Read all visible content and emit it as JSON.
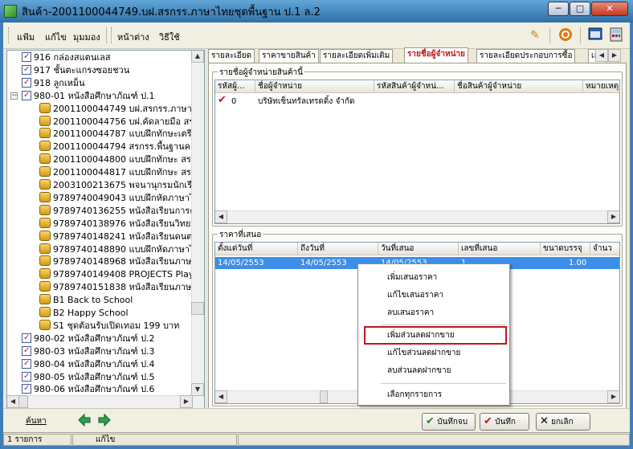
{
  "window": {
    "title": "สินค้า-2001100044749.บฝ.สรกรร.ภาษาไทยชุดพื้นฐาน ป.1 ล.2",
    "minimize": "─",
    "maximize": "□",
    "close": "✕"
  },
  "menu": {
    "items": [
      "แฟ้ม",
      "แก้ไข",
      "มุมมอง",
      "หน้าต่าง",
      "วิธีใช้"
    ]
  },
  "tree": {
    "rows": [
      {
        "kind": "cat",
        "text": "916 กล่องสแตนเลส"
      },
      {
        "kind": "cat",
        "text": "917 ชั้นตะแกรงซอยชวน"
      },
      {
        "kind": "cat",
        "text": "918 ลูกเหม็น"
      },
      {
        "kind": "cat",
        "text": "980-01 หนังสือศึกษาภัณฑ์ ป.1"
      },
      {
        "kind": "item",
        "text": "2001100044749 บฝ.สรกรร.ภาษาไท"
      },
      {
        "kind": "item",
        "text": "2001100044756 บฝ.คัดลายมือ สรกร"
      },
      {
        "kind": "item",
        "text": "2001100044787 แบบฝึกทักษะเตรีย"
      },
      {
        "kind": "item",
        "text": "2001100044794 สรกรร.พื้นฐานคณิต"
      },
      {
        "kind": "item",
        "text": "2001100044800 แบบฝึกทักษะ สรกร"
      },
      {
        "kind": "item",
        "text": "2001100044817 แบบฝึกทักษะ สรกร"
      },
      {
        "kind": "item",
        "text": "2003100213675 พจนานุกรมนักเรีย"
      },
      {
        "kind": "item",
        "text": "9789740049043 แบบฝึกหัดภาษาไท"
      },
      {
        "kind": "item",
        "text": "9789740136255 หนังสือเรียนการดำ"
      },
      {
        "kind": "item",
        "text": "9789740138976 หนังสือเรียนวิทยาศ"
      },
      {
        "kind": "item",
        "text": "9789740148241 หนังสือเรียนดนตรี-"
      },
      {
        "kind": "item",
        "text": "9789740148890 แบบฝึกหัดภาษาไท"
      },
      {
        "kind": "item",
        "text": "9789740148968 หนังสือเรียนภาษาไ"
      },
      {
        "kind": "item",
        "text": "9789740149408 PROJECTS Play &"
      },
      {
        "kind": "item",
        "text": "9789740151838 หนังสือเรียนภาษาไ"
      },
      {
        "kind": "item",
        "text": "B1 Back to School"
      },
      {
        "kind": "item",
        "text": "B2 Happy School"
      },
      {
        "kind": "item",
        "text": "S1 ชุดต้อนรับเปิดเทอม 199 บาท"
      },
      {
        "kind": "cat",
        "text": "980-02 หนังสือศึกษาภัณฑ์ ป.2"
      },
      {
        "kind": "cat",
        "text": "980-03 หนังสือศึกษาภัณฑ์ ป.3"
      },
      {
        "kind": "cat",
        "text": "980-04 หนังสือศึกษาภัณฑ์ ป.4"
      },
      {
        "kind": "cat",
        "text": "980-05 หนังสือศึกษาภัณฑ์ ป.5"
      },
      {
        "kind": "cat",
        "text": "980-06 หนังสือศึกษาภัณฑ์ ป.6"
      }
    ]
  },
  "tabs": [
    "รายละเอียด",
    "ราคาขายสินค้า",
    "รายละเอียดเพิ่มเติม",
    "รายชื่อผู้จำหน่าย",
    "รายละเอียดประกอบการซื้อ",
    "เลข"
  ],
  "vendors": {
    "group_title": "รายชื่อผู้จำหน่ายสินค้านี้",
    "columns": [
      "รหัสผู้...",
      "ชื่อผู้จำหน่าย",
      "รหัสสินค้าผู้จำหน่...",
      "ชื่อสินค้าผู้จำหน่าย",
      "หมายเหตุ"
    ],
    "rows": [
      {
        "code": "0",
        "name": "บริษัทเซ็นทรัลเทรดดิ้ง จำกัด"
      }
    ]
  },
  "quotes": {
    "group_title": "ราคาที่เสนอ",
    "columns": [
      "ตั้งแต่วันที่",
      "ถึงวันที่",
      "วันที่เสนอ",
      "เลขที่เสนอ",
      "ขนาดบรรจุ",
      "จำนว"
    ],
    "rows": [
      {
        "from": "14/05/2553",
        "to": "14/05/2553",
        "date": "14/05/2553",
        "no": "1",
        "pack": "1.00"
      }
    ]
  },
  "context_menu": {
    "items": [
      "เพิ่มเสนอราคา",
      "แก้ไขเสนอราคา",
      "ลบเสนอราคา",
      "เพิ่มส่วนลดฝากขาย",
      "แก้ไขส่วนลดฝากขาย",
      "ลบส่วนลดฝากขาย",
      "เลือกทุกรายการ"
    ],
    "highlighted": "เพิ่มส่วนลดฝากขาย"
  },
  "bottom": {
    "find_link": "ค้นหา",
    "save_continue": "บันทึกจบ",
    "save": "บันทึก",
    "cancel": "ยกเลิก"
  },
  "status": {
    "count": "1 รายการ",
    "mode": "แก้ไข"
  }
}
